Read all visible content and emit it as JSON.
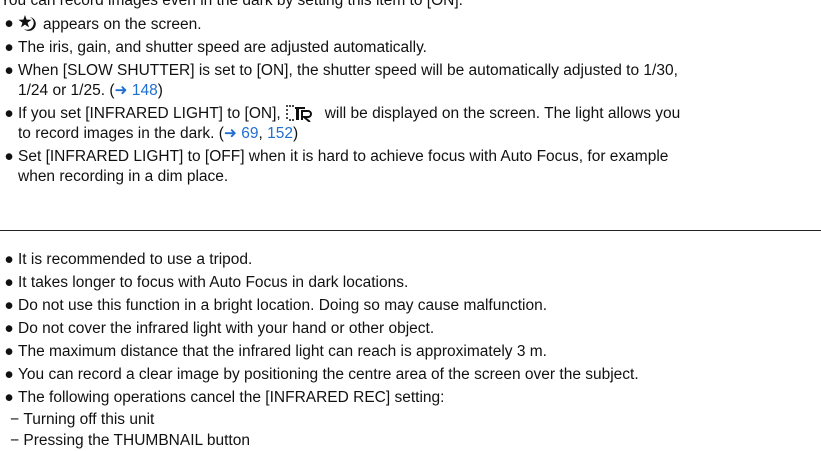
{
  "section1": {
    "intro": "You can record images even in the dark by setting this item to [ON].",
    "items": [
      {
        "bullet": "●",
        "text": "appears on the screen.",
        "icon": "night-mode-icon"
      },
      {
        "bullet": "●",
        "text": "The iris, gain, and shutter speed are adjusted automatically."
      },
      {
        "bullet": "●",
        "line1": "When [SLOW SHUTTER] is set to [ON], the shutter speed will be automatically adjusted to 1/30,",
        "line2_before": "1/24 or 1/25. (",
        "arrow": "➜",
        "link1": "148",
        "line2_after": ")"
      },
      {
        "bullet": "●",
        "line1_before": "If you set [INFRARED LIGHT] to [ON],",
        "icon": "infrared-ir-icon",
        "line1_after": "will be displayed on the screen. The light allows you",
        "line2_before": "to record images in the dark. (",
        "arrow": "➜",
        "link1": "69",
        "sep": ", ",
        "link2": "152",
        "line2_after": ")"
      },
      {
        "bullet": "●",
        "line1": "Set [INFRARED LIGHT] to [OFF] when it is hard to achieve focus with Auto Focus, for example",
        "line2": "when recording in a dim place."
      }
    ]
  },
  "section2": {
    "items": [
      "It is recommended to use a tripod.",
      "It takes longer to focus with Auto Focus in dark locations.",
      "Do not use this function in a bright location. Doing so may cause malfunction.",
      "Do not cover the infrared light with your hand or other object.",
      "The maximum distance that the infrared light can reach is approximately 3 m.",
      "You can record a clear image by positioning the centre area of the screen over the subject.",
      "The following operations cancel the [INFRARED REC] setting:"
    ],
    "bullet": "●",
    "subitems": [
      {
        "dash": "−",
        "text": "Turning off this unit"
      },
      {
        "dash": "−",
        "text": "Pressing the THUMBNAIL button"
      }
    ]
  },
  "colors": {
    "link": "#1f6fd1",
    "text": "#111111",
    "rule": "#222222"
  }
}
